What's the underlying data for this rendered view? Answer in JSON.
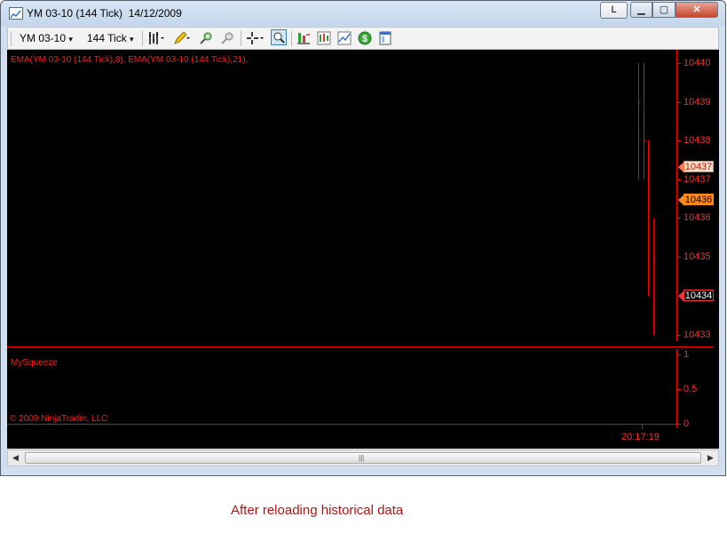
{
  "window": {
    "title": "YM 03-10 (144 Tick)  14/12/2009",
    "l_button": "L",
    "min_glyph": "▁",
    "max_glyph": "▢",
    "close_glyph": "✕"
  },
  "toolbar": {
    "instrument": "YM 03-10",
    "interval": "144 Tick",
    "dropdown_glyph": "▾"
  },
  "chart": {
    "price_panel_label": "EMA(YM 03-10 (144 Tick),8), EMA(YM 03-10 (144 Tick),21),",
    "indicator_panel_label": "MySqueeze",
    "copyright": "© 2009 NinjaTrader, LLC",
    "price_axis_labels": [
      "10440",
      "10439",
      "10438",
      "10437",
      "10436",
      "10435",
      "10433"
    ],
    "price_markers": [
      {
        "value": "10437",
        "style": "light-orange"
      },
      {
        "value": "10436",
        "style": "orange"
      },
      {
        "value": "10434",
        "style": "dark"
      }
    ],
    "indicator_axis_labels": [
      "1",
      "0.5",
      "0"
    ],
    "time_label": "20:17:19",
    "colors": {
      "background": "#000000",
      "foreground": "#ff0000"
    }
  },
  "chart_data": {
    "type": "bar",
    "title": "",
    "price_axis_ticks": [
      10440,
      10439,
      10438,
      10437,
      10436,
      10435,
      10433
    ],
    "bars": [
      {
        "high": 10440,
        "low": 10437,
        "close": 10439
      },
      {
        "high": 10440,
        "low": 10437,
        "close": 10438
      },
      {
        "high": 10438,
        "low": 10434,
        "close": 10437
      },
      {
        "high": 10436,
        "low": 10433,
        "close": 10435
      }
    ],
    "indicator_ticks": [
      1,
      0.5,
      0
    ]
  },
  "scrollbar": {
    "left_arrow": "◀",
    "right_arrow": "▶",
    "grip": "|||"
  },
  "caption": "After reloading historical data"
}
